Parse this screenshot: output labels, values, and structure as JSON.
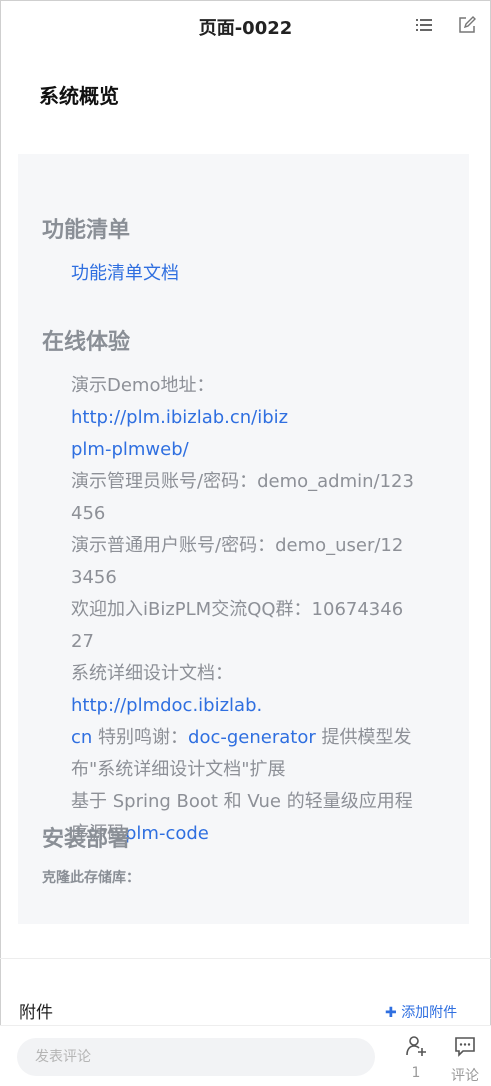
{
  "header": {
    "title": "页面-0022"
  },
  "page_heading": "系统概览",
  "sections": {
    "features": {
      "title": "功能清单",
      "doc_link": "功能清单文档"
    },
    "online": {
      "title": "在线体验",
      "demo_label": "演示Demo地址：",
      "demo_url_1": "http://plm.ibizlab.cn/ibiz",
      "demo_url_2": "plm-plmweb/",
      "admin_1": "演示管理员账号/密码：demo_admin/123",
      "admin_2": "456",
      "user_1": "演示普通用户账号/密码：demo_user/12",
      "user_2": "3456",
      "qq_1": "欢迎加入iBizPLM交流QQ群：10674346",
      "qq_2": "27",
      "doc_label": "系统详细设计文档：",
      "doc_url_1": "http://plmdoc.ibizlab.",
      "doc_url_2": "cn",
      "thanks": " 特别鸣谢：",
      "generator": "doc-generator",
      "gen_tail": " 提供模型发",
      "gen_tail2": "布\"系统详细设计文档\"扩展",
      "based_1": "基于 Spring Boot 和 Vue 的轻量级应用程",
      "based_2": "序源码",
      "plm_code": "plm-code"
    },
    "install": {
      "title": "安装部署",
      "clone_label": "克隆此存储库："
    }
  },
  "attachments": {
    "title": "附件",
    "add_label": "添加附件"
  },
  "bottom": {
    "comment_placeholder": "发表评论",
    "follow_count": "1",
    "comment_label": "评论"
  },
  "colors": {
    "link": "#2f6fe0",
    "muted": "#8d9097",
    "panel": "#f6f7f9"
  }
}
